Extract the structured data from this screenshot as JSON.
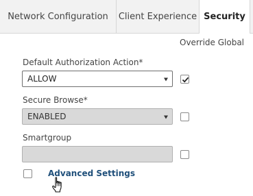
{
  "tabs": [
    {
      "label": "Network Configuration",
      "active": false
    },
    {
      "label": "Client Experience",
      "active": false
    },
    {
      "label": "Security",
      "active": true
    }
  ],
  "override_global_label": "Override Global",
  "fields": {
    "default_authorization": {
      "label": "Default Authorization Action*",
      "value": "ALLOW",
      "override_checked": true
    },
    "secure_browse": {
      "label": "Secure Browse*",
      "value": "ENABLED",
      "override_checked": false
    },
    "smartgroup": {
      "label": "Smartgroup",
      "value": "",
      "override_checked": false
    }
  },
  "advanced_settings": {
    "label": "Advanced Settings",
    "checked": false
  },
  "colors": {
    "link": "#1f4f7a",
    "disabled_field": "#d9d9d9",
    "tab_bar": "#f2f2f2"
  }
}
